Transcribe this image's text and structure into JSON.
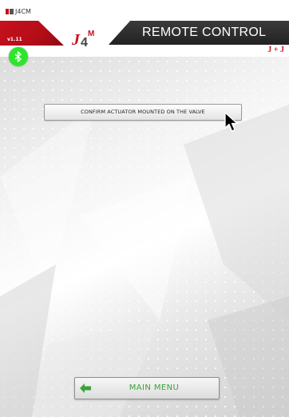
{
  "window": {
    "title": "J4CM"
  },
  "header": {
    "version": "v1.11",
    "title": "REMOTE CONTROL",
    "brand_logo_text": "J4M",
    "partner_logo_text": "J + J"
  },
  "status": {
    "bluetooth_icon": "bluetooth-icon",
    "bluetooth_color": "#2ee52e"
  },
  "main": {
    "confirm_button_label": "CONFIRM ACTUATOR MOUNTED ON THE VALVE",
    "menu_button_label": "MAIN MENU",
    "menu_button_color": "#3aa43a"
  },
  "colors": {
    "accent_red": "#c8101e",
    "header_dark": "#2b2b2b"
  }
}
